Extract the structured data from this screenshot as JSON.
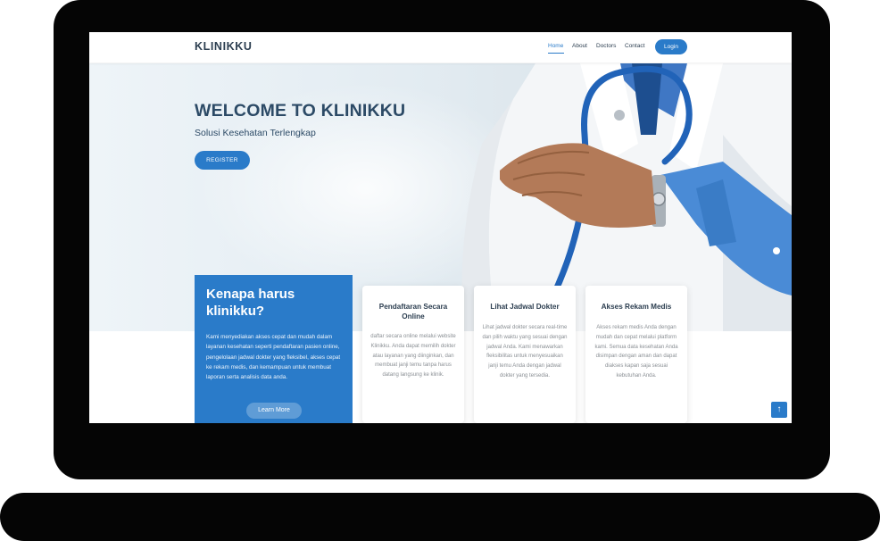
{
  "brand": {
    "logo": "KLINIKKU"
  },
  "nav": {
    "home": "Home",
    "about": "About",
    "doctors": "Doctors",
    "contact": "Contact",
    "login": "Login"
  },
  "hero": {
    "title": "WELCOME TO KLINIKKU",
    "subtitle": "Solusi Kesehatan Terlengkap",
    "register": "REGISTER"
  },
  "why": {
    "title": "Kenapa harus klinikku?",
    "text": "Kami menyediakan akses cepat dan mudah dalam layanan kesehatan seperti pendaftaran pasien online, pengelolaan jadwal dokter yang fleksibel, akses cepat ke rekam medis, dan kemampuan untuk membuat laporan serta analisis data anda.",
    "button": "Learn More"
  },
  "features": [
    {
      "title": "Pendaftaran Secara Online",
      "text": "daftar secara online melalui website Klinikku. Anda dapat memilih dokter atau layanan yang diinginkan, dan membuat janji temu tanpa harus datang langsung ke klinik."
    },
    {
      "title": "Lihat Jadwal Dokter",
      "text": "Lihat jadwal dokter secara real-time dan pilih waktu yang sesuai dengan jadwal Anda. Kami menawarkan fleksibilitas untuk menyesuaikan janji temu Anda dengan jadwal dokter yang tersedia."
    },
    {
      "title": "Akses Rekam Medis",
      "text": "Akses rekam medis Anda dengan mudah dan cepat melalui platform kami. Semua data kesehatan Anda disimpan dengan aman dan dapat diakses kapan saja sesuai kebutuhan Anda."
    }
  ],
  "scroll_top": "↑",
  "colors": {
    "accent": "#2a7bc9",
    "heading": "#2c4a66",
    "bezel": "#050505"
  }
}
